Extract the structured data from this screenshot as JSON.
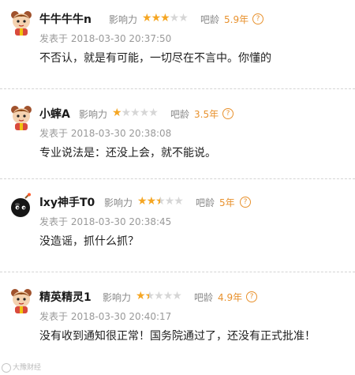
{
  "labels": {
    "influence": "影响力",
    "bar_age": "吧龄",
    "posted_prefix": "发表于",
    "help_glyph": "?"
  },
  "comments": [
    {
      "name": "牛牛牛牛n",
      "rating": 3,
      "max_rating": 5,
      "bar_age": "5.9年",
      "posted": "2018-03-30 20:37:50",
      "text": "不否认，就是有可能，一切尽在不言中。你懂的",
      "avatar_icon": "cartoon-avatar-icon"
    },
    {
      "name": "小蟀A",
      "rating": 1,
      "max_rating": 5,
      "bar_age": "3.5年",
      "posted": "2018-03-30 20:38:08",
      "text": "专业说法是：还没上会，就不能说。",
      "avatar_icon": "cartoon-avatar-icon"
    },
    {
      "name": "lxy神手T0",
      "rating": 2.5,
      "max_rating": 5,
      "bar_age": "5年",
      "posted": "2018-03-30 20:38:45",
      "text": "没造谣，抓什么抓？",
      "avatar_icon": "bomb-avatar-icon"
    },
    {
      "name": "精英精灵1",
      "rating": 1.5,
      "max_rating": 5,
      "bar_age": "4.9年",
      "posted": "2018-03-30 20:40:17",
      "text": "没有收到通知很正常！国务院通过了，还没有正式批准！",
      "avatar_icon": "cartoon-avatar-icon"
    }
  ],
  "watermark": {
    "icon": "weibo-icon",
    "text": "大豫财经"
  }
}
